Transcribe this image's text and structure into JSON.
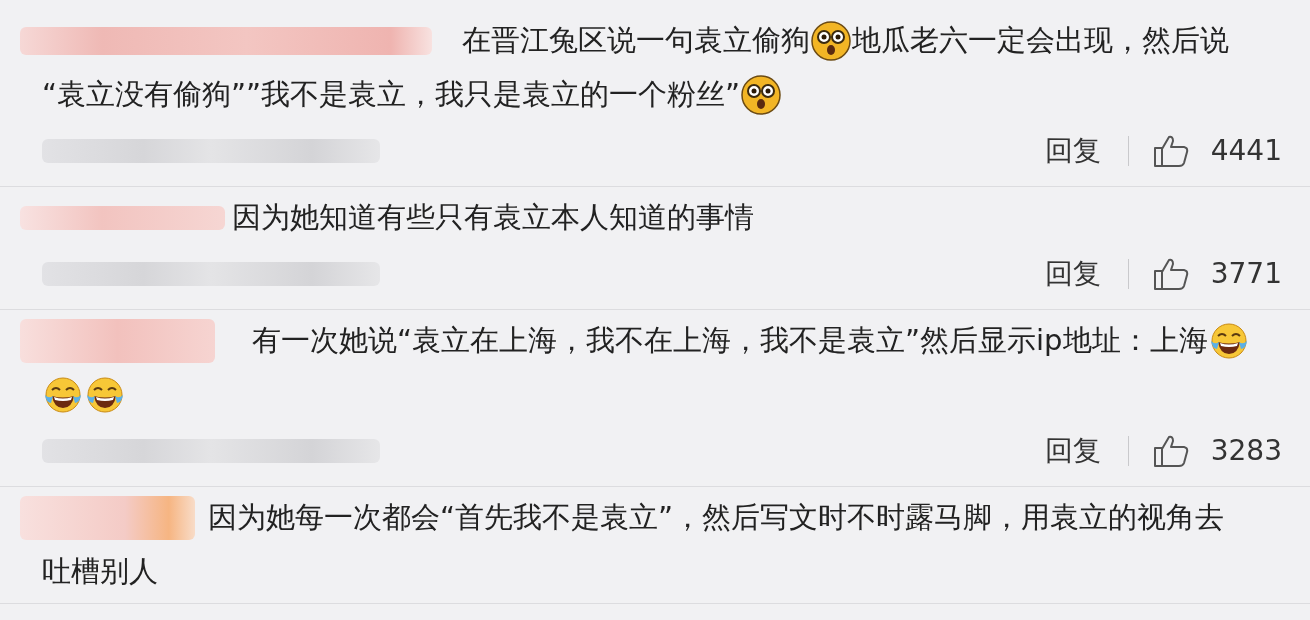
{
  "comments": [
    {
      "lines": [
        [
          {
            "kind": "text",
            "text": "在晋江兔区说一句袁立偷狗"
          },
          {
            "kind": "stunned"
          },
          {
            "kind": "text",
            "text": "地瓜老六一定会出现，然后说"
          }
        ],
        [
          {
            "kind": "text",
            "text": "“袁立没有偷狗””我不是袁立，我只是袁立的一个粉丝”"
          },
          {
            "kind": "stunned"
          }
        ]
      ],
      "reply": "回复",
      "likes": "4441"
    },
    {
      "lines": [
        [
          {
            "kind": "text",
            "text": "因为她知道有些只有袁立本人知道的事情"
          }
        ]
      ],
      "reply": "回复",
      "likes": "3771"
    },
    {
      "lines": [
        [
          {
            "kind": "text",
            "text": "有一次她说“袁立在上海，我不在上海，我不是袁立”然后显示ip地址：上海"
          },
          {
            "kind": "laughing"
          }
        ],
        [
          {
            "kind": "laughing"
          },
          {
            "kind": "laughing"
          }
        ]
      ],
      "reply": "回复",
      "likes": "3283"
    },
    {
      "lines": [
        [
          {
            "kind": "text",
            "text": "因为她每一次都会“首先我不是袁立”，然后写文时不时露马脚，用袁立的视角去"
          }
        ],
        [
          {
            "kind": "text",
            "text": "吐槽别人"
          }
        ]
      ]
    }
  ]
}
